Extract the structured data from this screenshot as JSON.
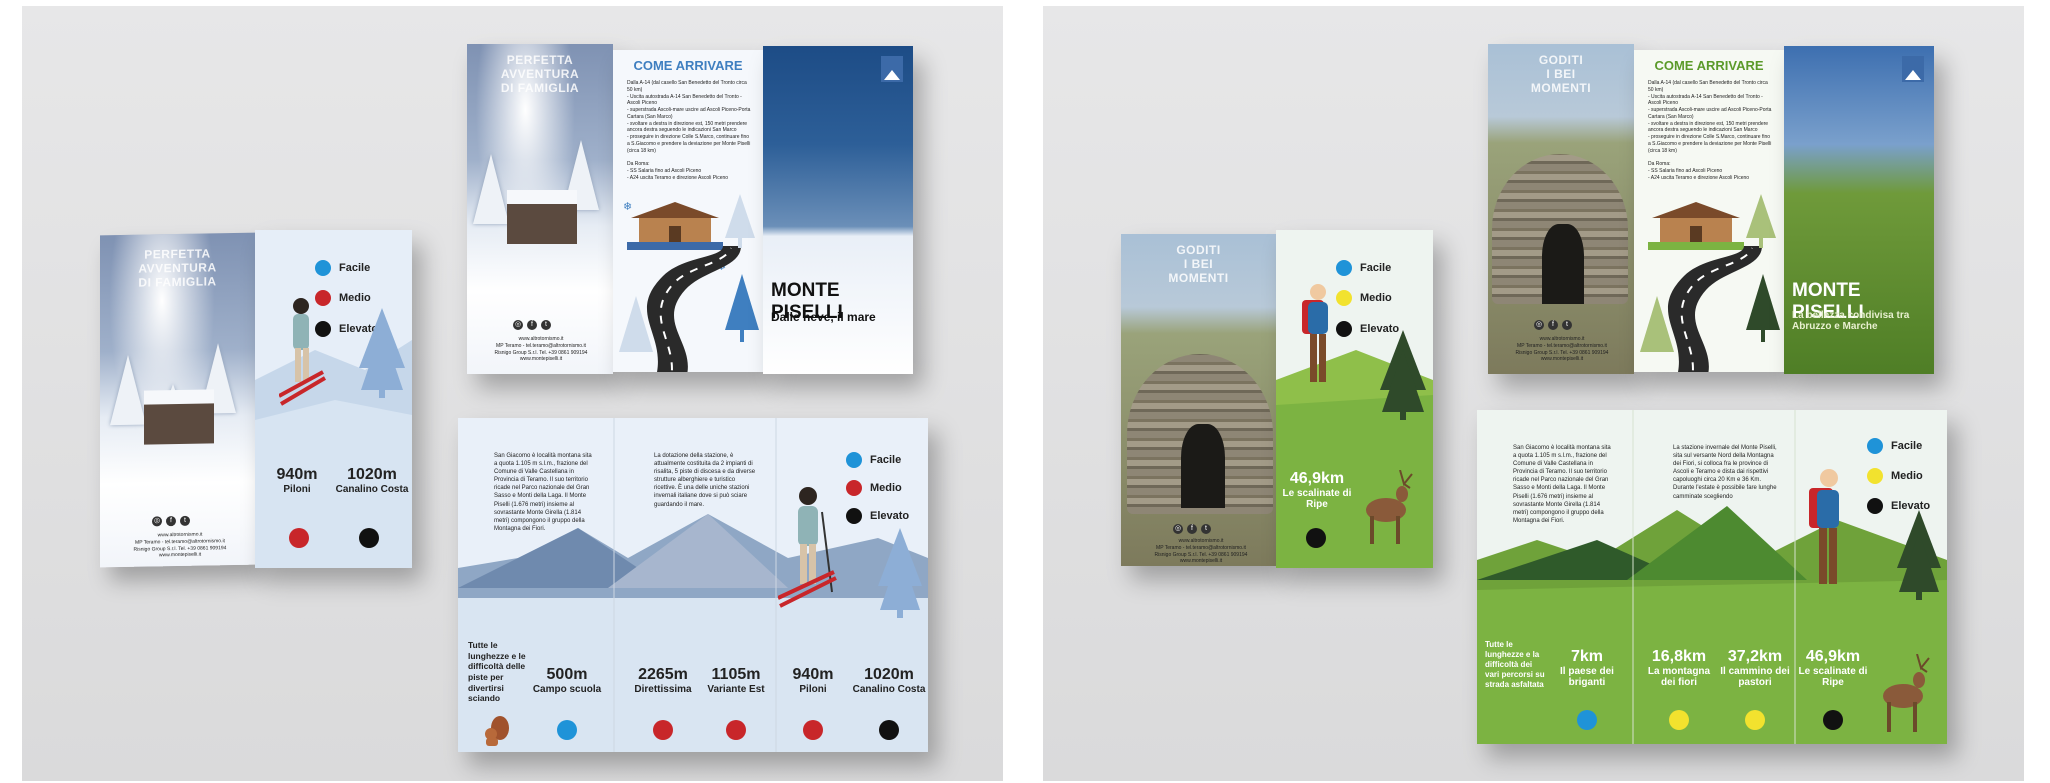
{
  "winter": {
    "panel_title": "PERFETTA\nAVVENTURA\nDI FAMIGLIA",
    "come_arrivare": "COME ARRIVARE",
    "directions": "Dalla A-14 (dal casello San Benedetto del Tronto circa 50 km)\n- Uscita autostrada A-14 San Benedetto del Tronto - Ascoli Piceno\n- superstrada Ascoli-mare uscire ad Ascoli Piceno-Porta Cartara (San Marco)\n- svoltare a destra in direzione est, 150 metri prendere ancora destra seguendo le indicazioni San Marco\n- proseguire in direzione Colle S.Marco, continuare fino a S.Giacomo e prendere la deviazione per Monte Piselli (circa 18 km)\n\nDa Roma:\n- SS Salaria fino ad Ascoli Piceno\n- A24 uscita Teramo e direzione Ascoli Piceno",
    "cover_title": "MONTE PISELLI",
    "cover_subtitle": "Dalle neve, il mare",
    "contact": "www.altrotornismo.it\nMP Teramo - tel.teramo@altrotornismo.it\nRisnigo Group S.r.l. Tel. +39 0861 909194\nwww.montepiselli.it",
    "legend": [
      {
        "label": "Facile",
        "color": "#1f93d8"
      },
      {
        "label": "Medio",
        "color": "#c8262a"
      },
      {
        "label": "Elevato",
        "color": "#111111"
      }
    ],
    "intro_text": "San Giacomo è località montana sita a quota 1.105 m s.l.m., frazione del Comune di Valle Castellana in Provincia di Teramo. Il suo territorio ricade nel Parco nazionale del Gran Sasso e Monti della Laga. Il Monte Piselli (1.676 metri) insieme al sovrastante Monte Girella (1.814 metri) compongono il gruppo della Montagna dei Fiori.",
    "station_text": "La dotazione della stazione, è attualmente costituita da 2 impianti di risalita, 5 piste di discesa e da diverse strutture alberghiere e turistico ricettive. È una delle uniche stazioni invernali italiane dove si può sciare guardando il mare.",
    "footnote": "Tutte le lunghezze e le difficoltà delle piste per divertirsi sciando",
    "slopes": [
      {
        "value": "500m",
        "name": "Campo scuola",
        "color": "#1f93d8"
      },
      {
        "value": "2265m",
        "name": "Direttissima",
        "color": "#c8262a"
      },
      {
        "value": "1105m",
        "name": "Variante Est",
        "color": "#c8262a"
      },
      {
        "value": "940m",
        "name": "Piloni",
        "color": "#c8262a"
      },
      {
        "value": "1020m",
        "name": "Canalino Costa",
        "color": "#111111"
      }
    ]
  },
  "summer": {
    "panel_title": "GODITI\nI BEI\nMOMENTI",
    "come_arrivare": "COME ARRIVARE",
    "cover_title": "MONTE PISELLI",
    "cover_subtitle": "La bellezza condivisa tra Abruzzo e Marche",
    "legend": [
      {
        "label": "Facile",
        "color": "#1f93d8"
      },
      {
        "label": "Medio",
        "color": "#f2e22e"
      },
      {
        "label": "Elevato",
        "color": "#111111"
      }
    ],
    "intro_text": "San Giacomo è località montana sita a quota 1.105 m s.l.m., frazione del Comune di Valle Castellana in Provincia di Teramo. Il suo territorio ricade nel Parco nazionale del Gran Sasso e Monti della Laga. Il Monte Piselli (1.676 metri) insieme al sovrastante Monte Girella (1.814 metri) compongono il gruppo della Montagna dei Fiori.",
    "station_text": "La stazione invernale del Monte Piselli, sita sul versante Nord della Montagna dei Fiori, si colloca fra le province di Ascoli e Teramo e dista dai rispettivi capoluoghi circa 20 Km e 36 Km. Durante l'estate è possibile fare lunghe camminate scegliendo",
    "footnote": "Tutte le lunghezze e la difficoltà dei vari percorsi su strada asfaltata",
    "trails": [
      {
        "value": "7km",
        "name": "Il paese dei briganti",
        "color": "#1f93d8"
      },
      {
        "value": "16,8km",
        "name": "La montagna dei fiori",
        "color": "#f2e22e"
      },
      {
        "value": "37,2km",
        "name": "Il cammino dei pastori",
        "color": "#f2e22e"
      },
      {
        "value": "46,9km",
        "name": "Le scalinate di Ripe",
        "color": "#111111"
      }
    ]
  },
  "icons": [
    "instagram-icon",
    "facebook-icon",
    "twitter-icon",
    "road-icon",
    "chalet-icon",
    "skier-icon",
    "hiker-icon",
    "deer-icon",
    "squirrel-icon",
    "pine-tree-icon",
    "snowflake-icon"
  ]
}
